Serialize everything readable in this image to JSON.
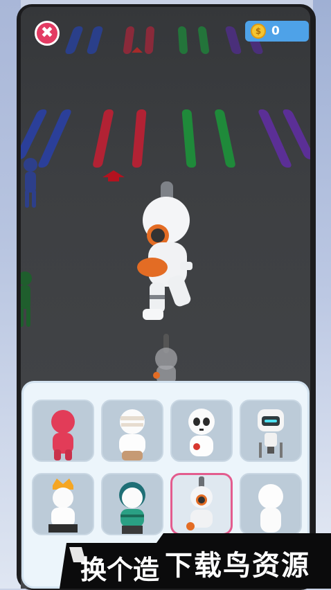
{
  "hud": {
    "close_symbol": "✖",
    "coin_symbol": "$",
    "coin_count": "0"
  },
  "colors": {
    "close": "#e33b63",
    "coin_panel": "#4ea2e8",
    "selected_border": "#e35c8e",
    "banner_bg": "#0b0b0c"
  },
  "skins": [
    {
      "name": "red-stickman",
      "selected": false
    },
    {
      "name": "bandage-mummy",
      "selected": false
    },
    {
      "name": "skull-skeleton",
      "selected": false
    },
    {
      "name": "robot",
      "selected": false
    },
    {
      "name": "crowned-king",
      "selected": false
    },
    {
      "name": "green-hair-boy",
      "selected": false
    },
    {
      "name": "astronaut",
      "selected": true
    },
    {
      "name": "plain-white",
      "selected": false
    }
  ],
  "banner": {
    "left_text": "换个造",
    "right_text": "下载鸟资源"
  }
}
